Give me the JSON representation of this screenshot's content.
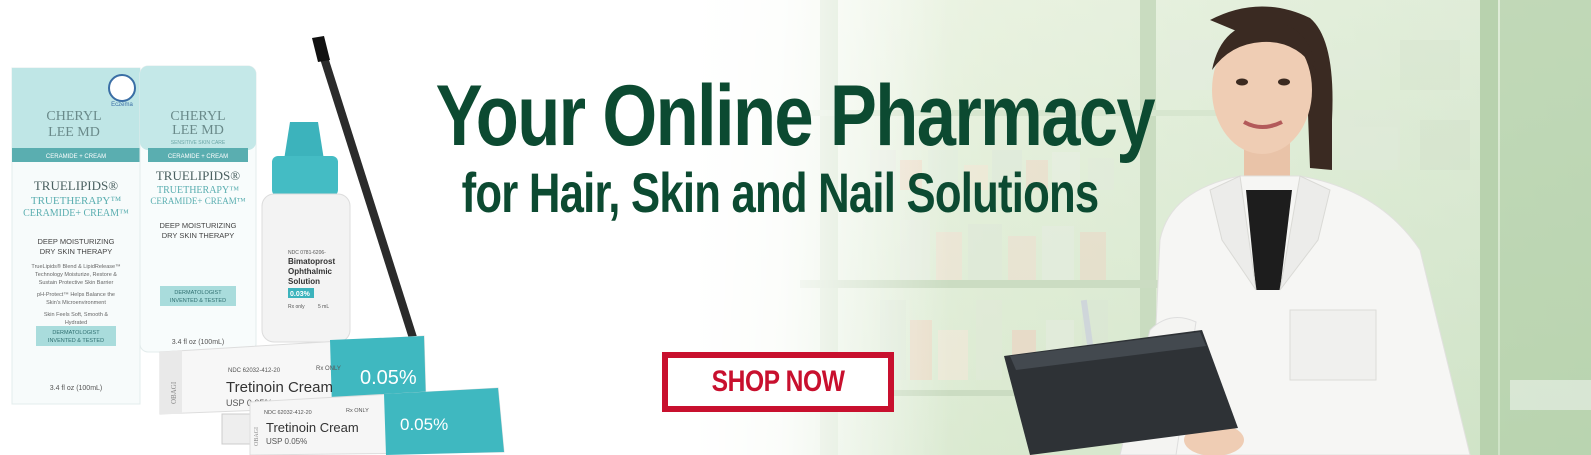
{
  "headline": {
    "title": "Your Online Pharmacy",
    "subtitle": "for Hair, Skin and Nail Solutions"
  },
  "cta": {
    "label": "SHOP NOW"
  },
  "colors": {
    "headline": "#0c4a31",
    "cta": "#c8102e",
    "product_teal": "#4dbfc3"
  },
  "products": {
    "box": {
      "brand1": "CHERYL",
      "brand2": "LEE MD",
      "category": "CERAMIDE + CREAM",
      "name1": "TRUELIPIDS®",
      "name2": "TRUETHERAPY™",
      "name3": "CERAMIDE+ CREAM™",
      "tagline1": "DEEP MOISTURIZING",
      "tagline2": "DRY SKIN THERAPY",
      "benefit1": "TrueLipids® Blend & LipidRelease™",
      "benefit2": "Technology Moisturize, Restore &",
      "benefit3": "Sustain Protective Skin Barrier",
      "benefit4": "pH-Protect™ Helps Balance the",
      "benefit5": "Skin's Microenvironment",
      "benefit6": "Skin Feels Soft, Smooth &",
      "benefit7": "Hydrated",
      "badge1": "DERMATOLOGIST",
      "badge2": "INVENTED & TESTED",
      "volume": "3.4 fl oz (100mL)",
      "seal": "Eczema"
    },
    "tube": {
      "brand1": "CHERYL",
      "brand2": "LEE MD",
      "line": "SENSITIVE SKIN CARE",
      "category": "CERAMIDE + CREAM",
      "name1": "TRUELIPIDS®",
      "name2": "TRUETHERAPY™",
      "name3": "CERAMIDE+ CREAM™",
      "tagline1": "DEEP MOISTURIZING",
      "tagline2": "DRY SKIN THERAPY",
      "badge1": "DERMATOLOGIST",
      "badge2": "INVENTED & TESTED",
      "volume": "3.4 fl oz (100mL)"
    },
    "bottle": {
      "ndc": "NDC 0781-6206-",
      "name1": "Bimatoprost",
      "name2": "Ophthalmic",
      "name3": "Solution",
      "strength": "0.03%",
      "rx": "Rx only",
      "volume": "5 mL"
    },
    "tretinoin_box": {
      "ndc": "NDC 62032-412-20",
      "rx": "Rx ONLY",
      "name": "Tretinoin Cream",
      "usp": "USP 0.05%",
      "strength": "0.05%",
      "brand": "OBAGI"
    },
    "tretinoin_tube": {
      "ndc": "NDC 62032-412-20",
      "rx": "Rx ONLY",
      "name": "Tretinoin Cream",
      "usp": "USP 0.05%",
      "strength": "0.05%",
      "brand": "OBAGI"
    }
  }
}
